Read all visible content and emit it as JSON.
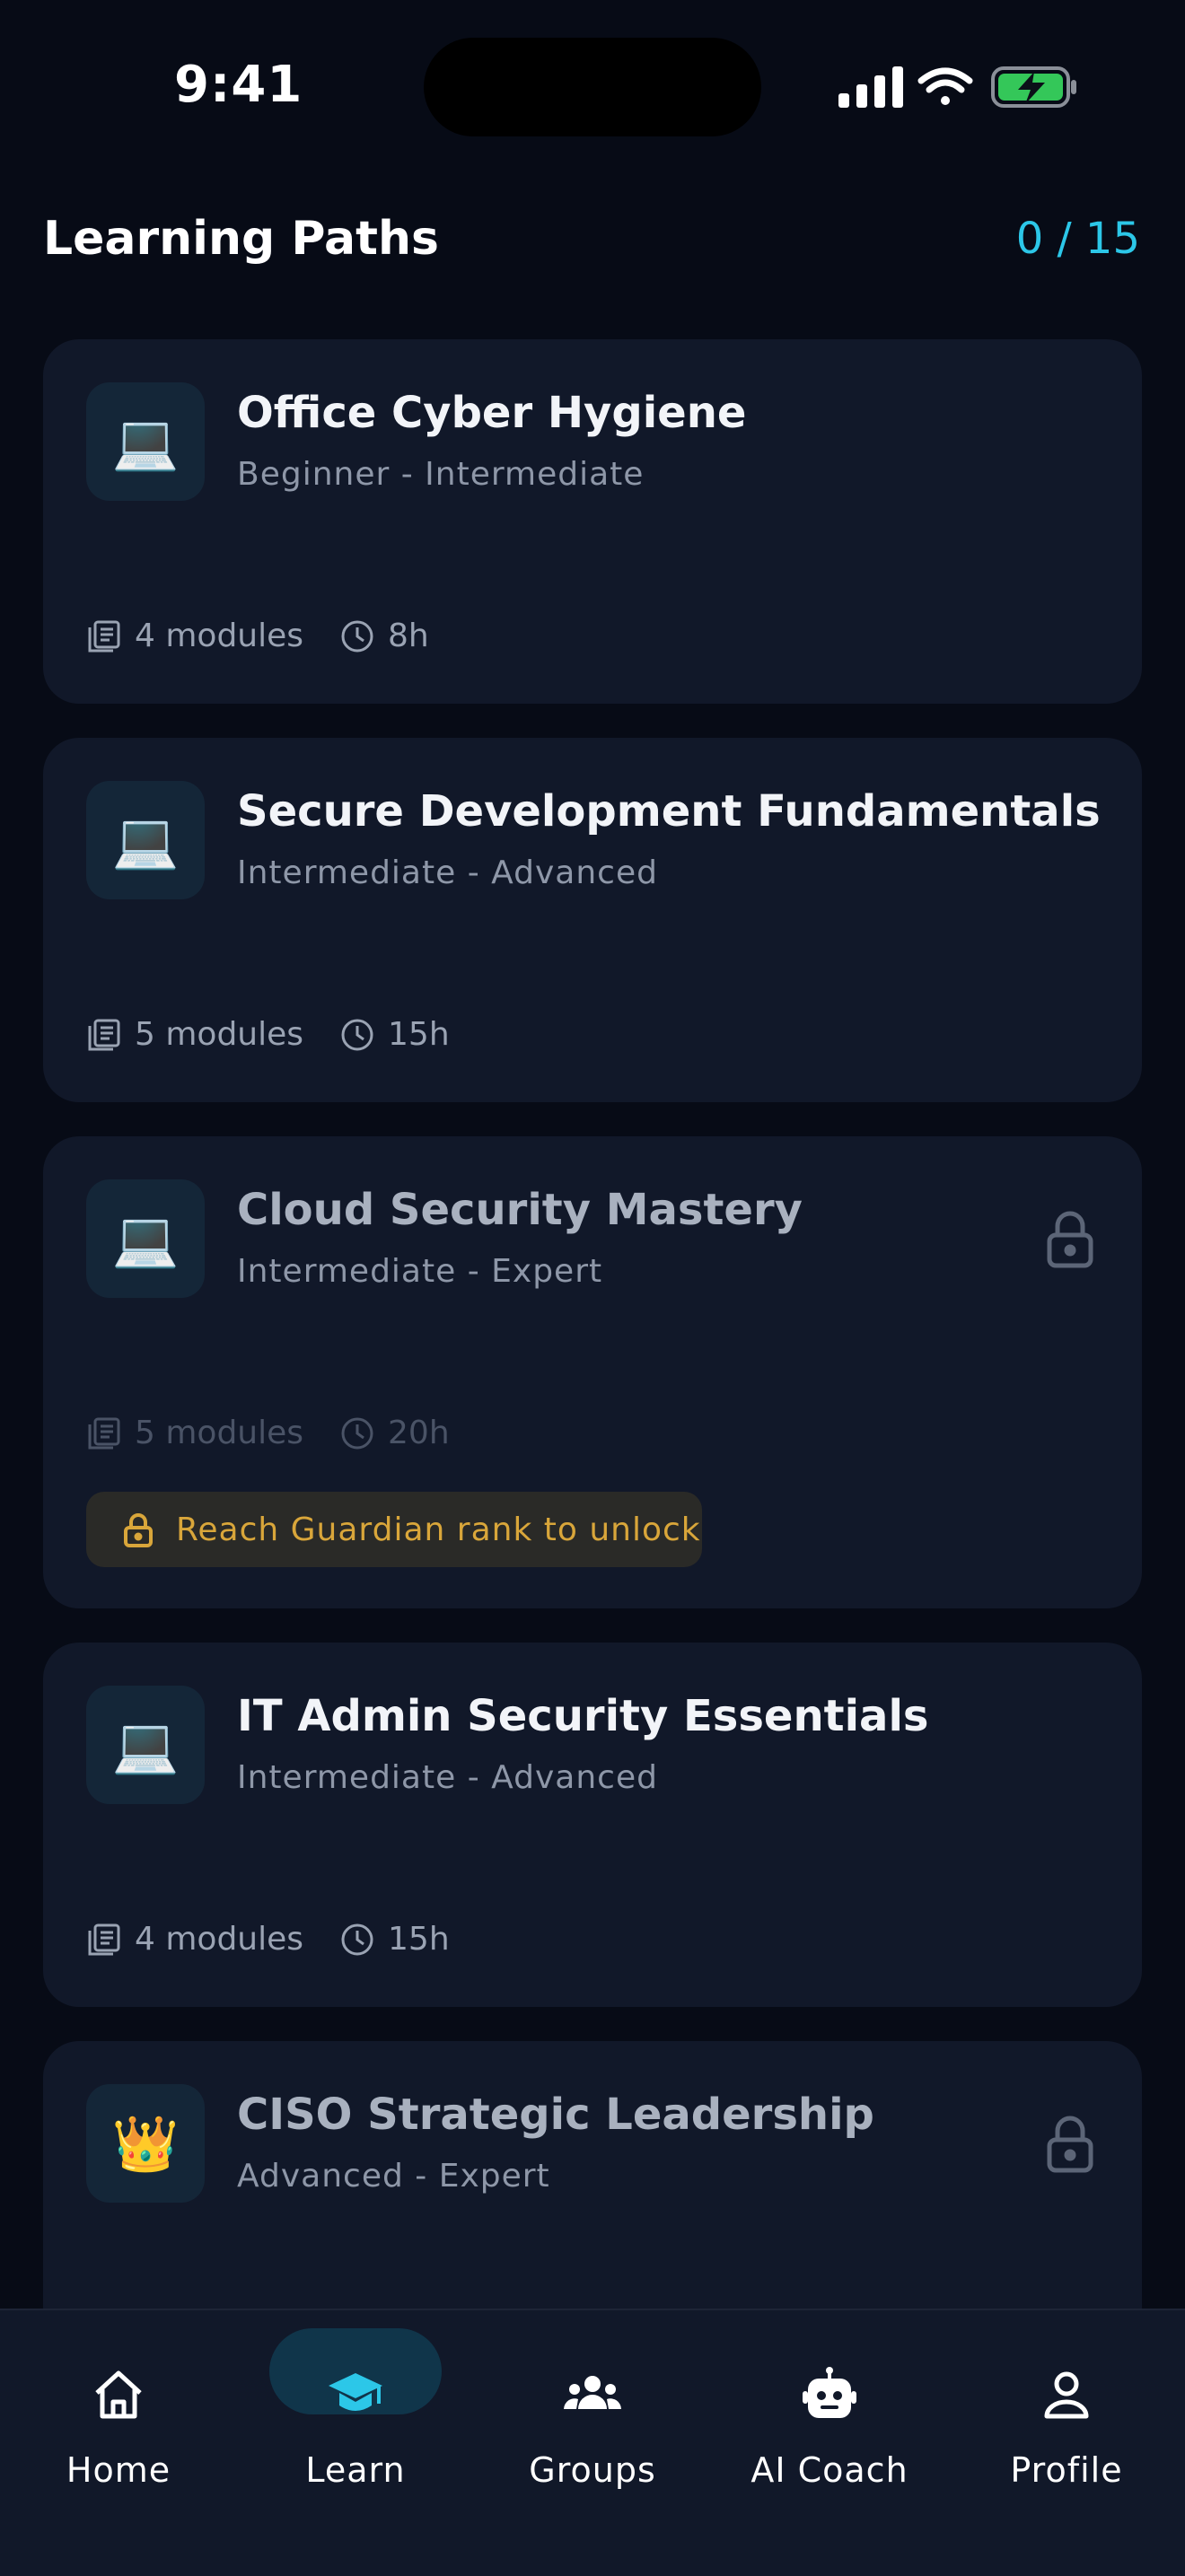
{
  "status_bar": {
    "time": "9:41"
  },
  "header": {
    "title": "Learning Paths",
    "progress": "0 / 15"
  },
  "cards": [
    {
      "emoji": "💻",
      "title": "Office Cyber Hygiene",
      "level": "Beginner - Intermediate",
      "modules": "4 modules",
      "duration": "8h",
      "locked": false
    },
    {
      "emoji": "💻",
      "title": "Secure Development Fundamentals",
      "level": "Intermediate - Advanced",
      "modules": "5 modules",
      "duration": "15h",
      "locked": false
    },
    {
      "emoji": "💻",
      "title": "Cloud Security Mastery",
      "level": "Intermediate - Expert",
      "modules": "5 modules",
      "duration": "20h",
      "locked": true,
      "unlock_text": "Reach Guardian rank to unlock"
    },
    {
      "emoji": "💻",
      "title": "IT Admin Security Essentials",
      "level": "Intermediate - Advanced",
      "modules": "4 modules",
      "duration": "15h",
      "locked": false
    },
    {
      "emoji": "👑",
      "title": "CISO Strategic Leadership",
      "level": "Advanced - Expert",
      "locked": true
    }
  ],
  "nav": {
    "items": [
      {
        "label": "Home",
        "icon": "home-icon",
        "active": false
      },
      {
        "label": "Learn",
        "icon": "graduation-cap-icon",
        "active": true
      },
      {
        "label": "Groups",
        "icon": "groups-icon",
        "active": false
      },
      {
        "label": "AI Coach",
        "icon": "robot-icon",
        "active": false
      },
      {
        "label": "Profile",
        "icon": "user-icon",
        "active": false
      }
    ]
  },
  "colors": {
    "accent": "#2cc7e8",
    "background": "#070b16",
    "card": "#111829",
    "warning": "#d9a63a"
  }
}
